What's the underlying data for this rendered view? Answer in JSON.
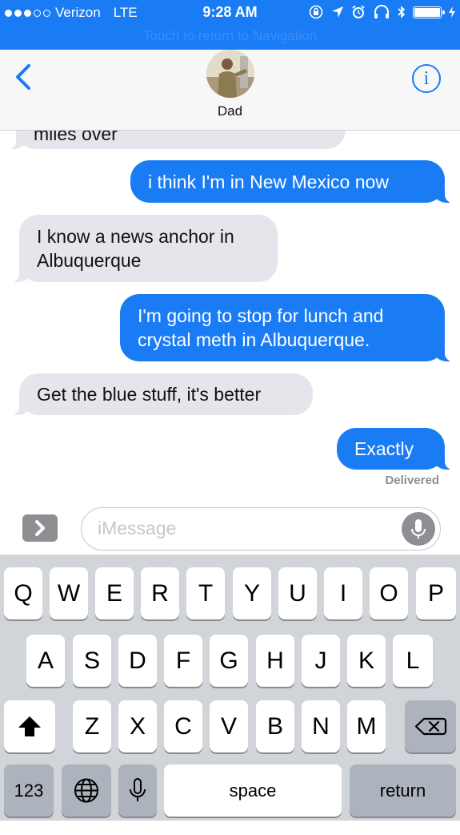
{
  "status_bar": {
    "carrier": "Verizon",
    "network": "LTE",
    "time": "9:28 AM",
    "return_banner": "Touch to return to Navigation"
  },
  "header": {
    "contact_name": "Dad",
    "info_label": "i"
  },
  "messages": [
    {
      "direction": "incoming",
      "text": "miles over"
    },
    {
      "direction": "outgoing",
      "text": "i think I'm  in New Mexico now"
    },
    {
      "direction": "incoming",
      "lines": [
        "I know a news anchor in",
        "Albuquerque"
      ]
    },
    {
      "direction": "outgoing",
      "lines": [
        "I'm going to stop for lunch and",
        "crystal meth in Albuquerque."
      ]
    },
    {
      "direction": "incoming",
      "text": "Get the blue stuff, it's better"
    },
    {
      "direction": "outgoing",
      "text": "Exactly"
    }
  ],
  "delivery_status": "Delivered",
  "composer": {
    "placeholder": "iMessage"
  },
  "keyboard": {
    "row1": [
      "Q",
      "W",
      "E",
      "R",
      "T",
      "Y",
      "U",
      "I",
      "O",
      "P"
    ],
    "row2": [
      "A",
      "S",
      "D",
      "F",
      "G",
      "H",
      "J",
      "K",
      "L"
    ],
    "row3": [
      "Z",
      "X",
      "C",
      "V",
      "B",
      "N",
      "M"
    ],
    "numbers_key": "123",
    "space_key": "space",
    "return_key": "return"
  },
  "colors": {
    "accent_blue": "#1a7cf5",
    "incoming_bubble": "#e6e5eb",
    "keyboard_bg": "#d1d4d9",
    "special_key": "#acb3bc"
  }
}
